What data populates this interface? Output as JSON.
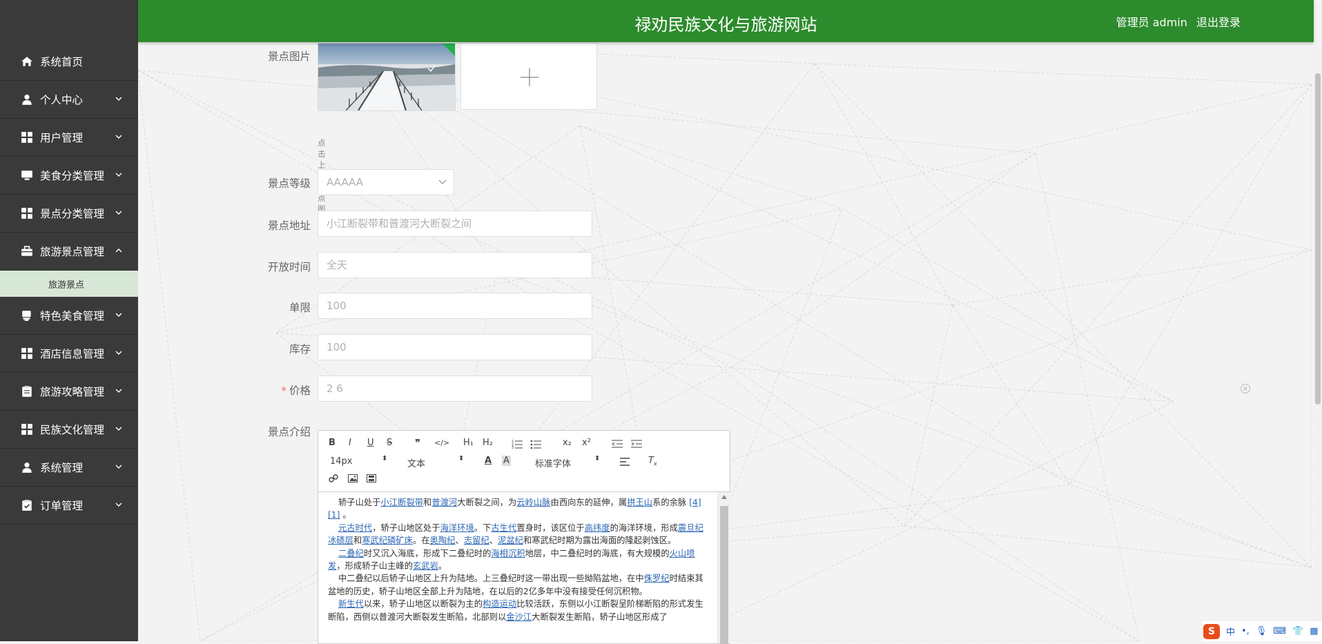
{
  "header": {
    "title": "禄劝民族文化与旅游网站",
    "user_label": "管理员 admin",
    "logout_label": "退出登录"
  },
  "sidebar": {
    "items": [
      {
        "label": "系统首页",
        "icon": "home-icon",
        "expandable": false
      },
      {
        "label": "个人中心",
        "icon": "person-icon",
        "expandable": true
      },
      {
        "label": "用户管理",
        "icon": "grid-icon",
        "expandable": true
      },
      {
        "label": "美食分类管理",
        "icon": "monitor-icon",
        "expandable": true
      },
      {
        "label": "景点分类管理",
        "icon": "grid-icon",
        "expandable": true
      },
      {
        "label": "旅游景点管理",
        "icon": "briefcase-icon",
        "expandable": true,
        "expanded": true
      },
      {
        "label": "特色美食管理",
        "icon": "cup-icon",
        "expandable": true
      },
      {
        "label": "酒店信息管理",
        "icon": "grid-icon",
        "expandable": true
      },
      {
        "label": "旅游攻略管理",
        "icon": "clipboard-icon",
        "expandable": true
      },
      {
        "label": "民族文化管理",
        "icon": "grid-icon",
        "expandable": true
      },
      {
        "label": "系统管理",
        "icon": "person-icon",
        "expandable": true
      },
      {
        "label": "订单管理",
        "icon": "check-clipboard-icon",
        "expandable": true
      }
    ],
    "submenu": {
      "label": "旅游景点"
    }
  },
  "form": {
    "image_label": "景点图片",
    "upload_tip": "点击上传景点图片",
    "level_label": "景点等级",
    "level_value": "AAAAA",
    "address_label": "景点地址",
    "address_value": "小江断裂带和普渡河大断裂之间",
    "open_time_label": "开放时间",
    "open_time_value": "全天",
    "limit_label": "单限",
    "limit_value": "100",
    "stock_label": "库存",
    "stock_value": "100",
    "price_required": "*",
    "price_label": "价格",
    "price_value": "2 6",
    "intro_label": "景点介绍"
  },
  "editor": {
    "toolbar": {
      "bold": "B",
      "italic": "I",
      "underline": "U",
      "strike": "S",
      "quote": "❞",
      "code": "</>",
      "h1": "H₁",
      "h2": "H₂",
      "sub": "x₂",
      "sup": "x²",
      "size": "14px",
      "block": "文本",
      "font": "标准字体"
    },
    "paragraphs": [
      [
        {
          "t": "轿子山处于"
        },
        {
          "t": "小江断裂带",
          "link": true
        },
        {
          "t": "和"
        },
        {
          "t": "普渡河",
          "link": true
        },
        {
          "t": "大断裂之间，为"
        },
        {
          "t": "云岭山脉",
          "link": true
        },
        {
          "t": "由西向东的延伸，属"
        },
        {
          "t": "拱王山",
          "link": true
        },
        {
          "t": "系的余脉 "
        },
        {
          "t": "[4]",
          "link": true
        },
        {
          "t": " "
        },
        {
          "t": "[1]",
          "link": true
        },
        {
          "t": " 。"
        }
      ],
      [
        {
          "t": "元古时代",
          "link": true
        },
        {
          "t": "，轿子山地区处于"
        },
        {
          "t": "海洋环境",
          "link": true
        },
        {
          "t": "。下"
        },
        {
          "t": "古生代",
          "link": true
        },
        {
          "t": "置身时，该区位于"
        },
        {
          "t": "高纬度",
          "link": true
        },
        {
          "t": "的海洋环境，形成"
        },
        {
          "t": "震旦纪冰碛层",
          "link": true
        },
        {
          "t": "和"
        },
        {
          "t": "寒武纪磷矿床",
          "link": true
        },
        {
          "t": "。在"
        },
        {
          "t": "奥陶纪",
          "link": true
        },
        {
          "t": "、"
        },
        {
          "t": "志留纪",
          "link": true
        },
        {
          "t": "、"
        },
        {
          "t": "泥盆纪",
          "link": true
        },
        {
          "t": "和寒武纪时期为露出海面的隆起剥蚀区。"
        }
      ],
      [
        {
          "t": "二叠纪",
          "link": true
        },
        {
          "t": "时又沉入海底，形成下二叠纪时的"
        },
        {
          "t": "海相沉积",
          "link": true
        },
        {
          "t": "地层，中二叠纪时的海底，有大规模的"
        },
        {
          "t": "火山喷发",
          "link": true
        },
        {
          "t": "，形成轿子山主峰的"
        },
        {
          "t": "玄武岩",
          "link": true
        },
        {
          "t": "。"
        }
      ],
      [
        {
          "t": "中二叠纪以后轿子山地区上升为陆地。上三叠纪时这一带出现一些拗陷盆地，在中"
        },
        {
          "t": "侏罗纪",
          "link": true
        },
        {
          "t": "时结束其盆地的历史，轿子山地区全部上升为陆地，在以后的2亿多年中没有接受任何沉积物。"
        }
      ],
      [
        {
          "t": "新生代",
          "link": true
        },
        {
          "t": "以来，轿子山地区以断裂为主的"
        },
        {
          "t": "构造运动",
          "link": true
        },
        {
          "t": "比较活跃，东侧以小江断裂呈阶梯断陷的形式发生断陷，西侧以普渡河大断裂发生断陷，北部则以"
        },
        {
          "t": "金沙江",
          "link": true
        },
        {
          "t": "大断裂发生断陷，轿子山地区形成了"
        }
      ]
    ]
  },
  "ime": {
    "logo": "S",
    "lang": "中"
  },
  "colors": {
    "header": "#2c8b2c",
    "sidebar": "#3a3a3a",
    "submenu_active": "#d7e7d7",
    "link": "#2a66b4",
    "required": "#f56c6c"
  }
}
